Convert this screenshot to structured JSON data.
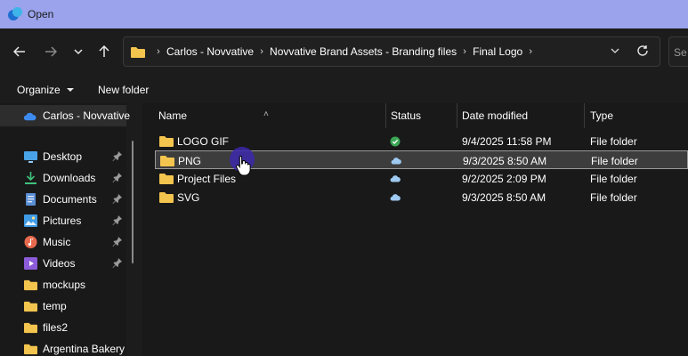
{
  "window": {
    "title": "Open",
    "titlebar_color": "#9aa3ec"
  },
  "nav": {
    "back_icon": "arrow-left-icon",
    "forward_icon": "arrow-right-icon",
    "recent_icon": "chevron-down-icon",
    "up_icon": "arrow-up-icon",
    "breadcrumbs": [
      "Carlos - Novvative",
      "Novvative Brand Assets - Branding files",
      "Final Logo"
    ],
    "search_placeholder": "Se"
  },
  "commands": {
    "organize": "Organize",
    "new_folder": "New folder"
  },
  "sidebar": {
    "items": [
      {
        "label": "Carlos - Novvative",
        "icon": "onedrive-cloud-icon",
        "pinned": false,
        "selected": true
      },
      {
        "label": "Desktop",
        "icon": "desktop-icon",
        "pinned": true
      },
      {
        "label": "Downloads",
        "icon": "download-icon",
        "pinned": true
      },
      {
        "label": "Documents",
        "icon": "documents-icon",
        "pinned": true
      },
      {
        "label": "Pictures",
        "icon": "pictures-icon",
        "pinned": true
      },
      {
        "label": "Music",
        "icon": "music-icon",
        "pinned": true
      },
      {
        "label": "Videos",
        "icon": "videos-icon",
        "pinned": true
      },
      {
        "label": "mockups",
        "icon": "folder-icon",
        "pinned": false
      },
      {
        "label": "temp",
        "icon": "folder-icon",
        "pinned": false
      },
      {
        "label": "files2",
        "icon": "folder-icon",
        "pinned": false
      },
      {
        "label": "Argentina Bakery",
        "icon": "folder-icon",
        "pinned": false
      }
    ]
  },
  "columns": {
    "name": "Name",
    "status": "Status",
    "date": "Date modified",
    "type": "Type"
  },
  "files": [
    {
      "name": "LOGO GIF",
      "status": "synced-check-icon",
      "date": "9/4/2025 11:58 PM",
      "type": "File folder"
    },
    {
      "name": "PNG",
      "status": "cloud-icon",
      "date": "9/3/2025 8:50 AM",
      "type": "File folder",
      "selected": true
    },
    {
      "name": "Project Files",
      "status": "cloud-icon",
      "date": "9/2/2025 2:09 PM",
      "type": "File folder"
    },
    {
      "name": "SVG",
      "status": "cloud-icon",
      "date": "9/3/2025 8:50 AM",
      "type": "File folder"
    }
  ],
  "colors": {
    "folder": "#f3c44e",
    "synced": "#3aa655",
    "cloud": "#9ec9f0",
    "selection": "#3d3d3d"
  }
}
